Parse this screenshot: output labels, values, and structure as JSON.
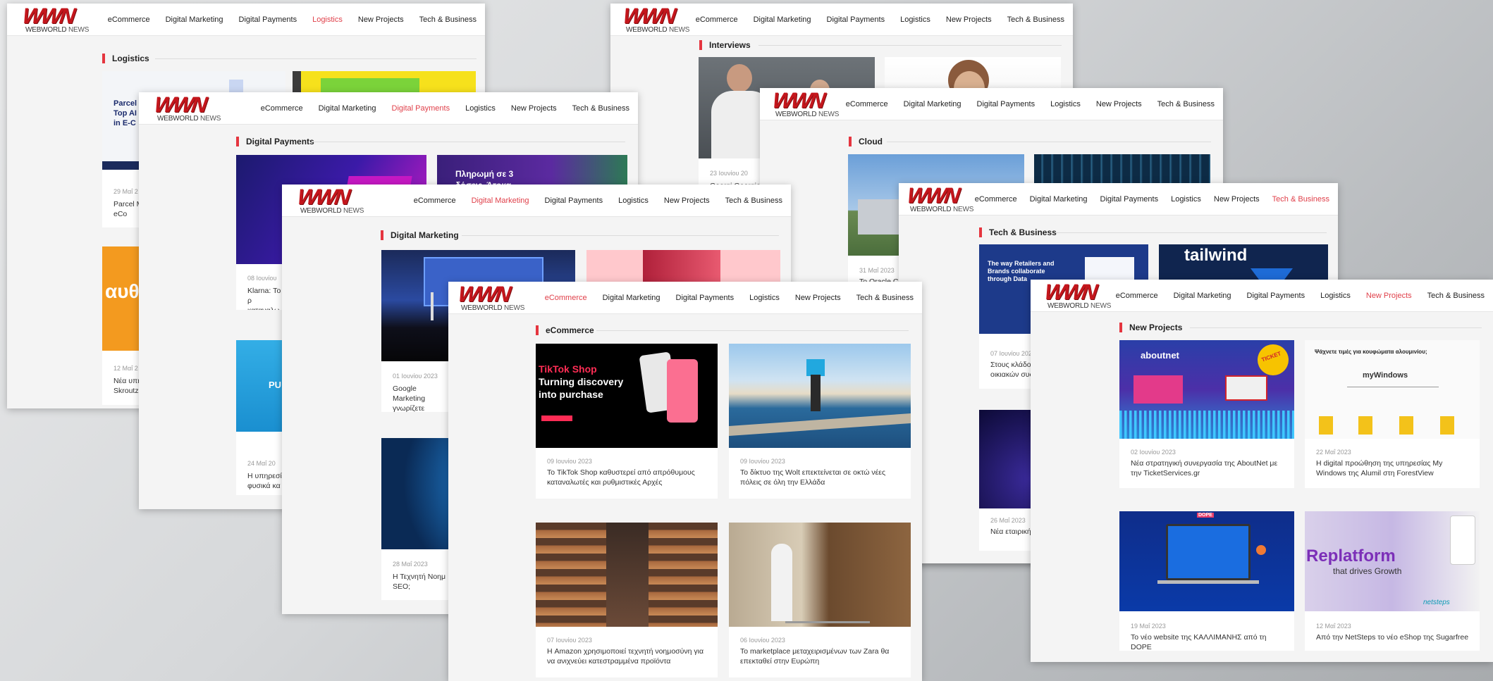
{
  "site": {
    "logo": "WWN",
    "logo_sub_bold": "WEBWORLD",
    "logo_sub": "NEWS",
    "nav": [
      "eCommerce",
      "Digital Marketing",
      "Digital Payments",
      "Logistics",
      "New Projects",
      "Tech & Business"
    ],
    "accent_color": "#e5353f"
  },
  "windows": {
    "logistics": {
      "section": "Logistics",
      "card1_text": "Parcel",
      "card1_text2": "Top AI",
      "card1_text3": "in E-C",
      "card1_date": "29 Μαΐ 2",
      "card1_title": "Parcel M στα eCo",
      "card2_date": "12 Μαΐ 2",
      "card2_title": "Νέα υπη Skroutz",
      "card2_overlay": "αυθ"
    },
    "payments": {
      "section": "Digital Payments",
      "card1_date": "08 Ιουνίου",
      "card1_title": "Klarna: Το ρ καταναλω",
      "card2_overlay1": "Πληρωμή σε 3",
      "card2_overlay2": "δόσεις. Άτοκα",
      "card3_date": "24 Μαΐ 20",
      "card3_title": "Η υπηρεσί φυσικά κα",
      "card3_overlay": "PU"
    },
    "interviews": {
      "section": "Interviews",
      "card1_date": "23 Ιουνίου 20",
      "card1_title": "Georgi Georgiev:"
    },
    "cloud": {
      "section": "Cloud",
      "card1_date": "31 Μαΐ 2023",
      "card1_title": "To Oracle Clo"
    },
    "marketing": {
      "section": "Digital Marketing",
      "card1_date": "01 Ιουνίου 2023",
      "card1_title": "Google Marketing γνωρίζετε",
      "card2_date": "28 Μαΐ 2023",
      "card2_title": "Η Τεχνητή Νοημ SEO;"
    },
    "tech": {
      "section": "Tech & Business",
      "card1_l1": "The way Retailers and",
      "card1_l2": "Brands collaborate",
      "card1_l3": "through Data",
      "card1_date": "07 Ιουνίου 2023",
      "card1_title": "Στους κλάδους οικιακών συσκ",
      "card2_brand": "tailwind",
      "card3_date": "26 Μαΐ 2023",
      "card3_title": "Νέα εταιρική τ"
    },
    "ecommerce": {
      "section": "eCommerce",
      "cards": [
        {
          "date": "09 Ιουνίου 2023",
          "title": "Το TikTok Shop καθυστερεί από απρόθυμους καταναλωτές και ρυθμιστικές Αρχές",
          "brand": "TikTok Shop",
          "tagline1": "Turning discovery",
          "tagline2": "into purchase"
        },
        {
          "date": "09 Ιουνίου 2023",
          "title": "Το δίκτυο της Wolt επεκτείνεται σε οκτώ νέες πόλεις σε όλη την Ελλάδα"
        },
        {
          "date": "07 Ιουνίου 2023",
          "title": "Η Amazon χρησιμοποιεί τεχνητή νοημοσύνη για να ανιχνεύει κατεστραμμένα προϊόντα"
        },
        {
          "date": "06 Ιουνίου 2023",
          "title": "To marketplace μεταχειρισμένων των Zara θα επεκταθεί στην Ευρώπη"
        }
      ]
    },
    "projects": {
      "section": "New Projects",
      "cards": [
        {
          "date": "02 Ιουνίου 2023",
          "title": "Νέα στρατηγική συνεργασία της AboutNet με την TicketServices.gr",
          "brand": "aboutnet",
          "badge": "TICKET"
        },
        {
          "date": "22 Μαΐ 2023",
          "title": "Η digital προώθηση της υπηρεσίας My Windows της Alumil στη ForestView",
          "headline": "Ψάχνετε τιμές για κουφώματα αλουμινίου;",
          "brand": "myWindows"
        },
        {
          "date": "19 Μαΐ 2023",
          "title": "Το νέο website της ΚΑΛΛΙΜΑΝΗΣ από τη DOPE",
          "brand": "DOPE"
        },
        {
          "date": "12 Μαΐ 2023",
          "title": "Από την NetSteps το νέο eShop της Sugarfree",
          "headline1": "Replatform",
          "headline2": "that drives Growth",
          "brand": "netsteps"
        }
      ]
    }
  }
}
